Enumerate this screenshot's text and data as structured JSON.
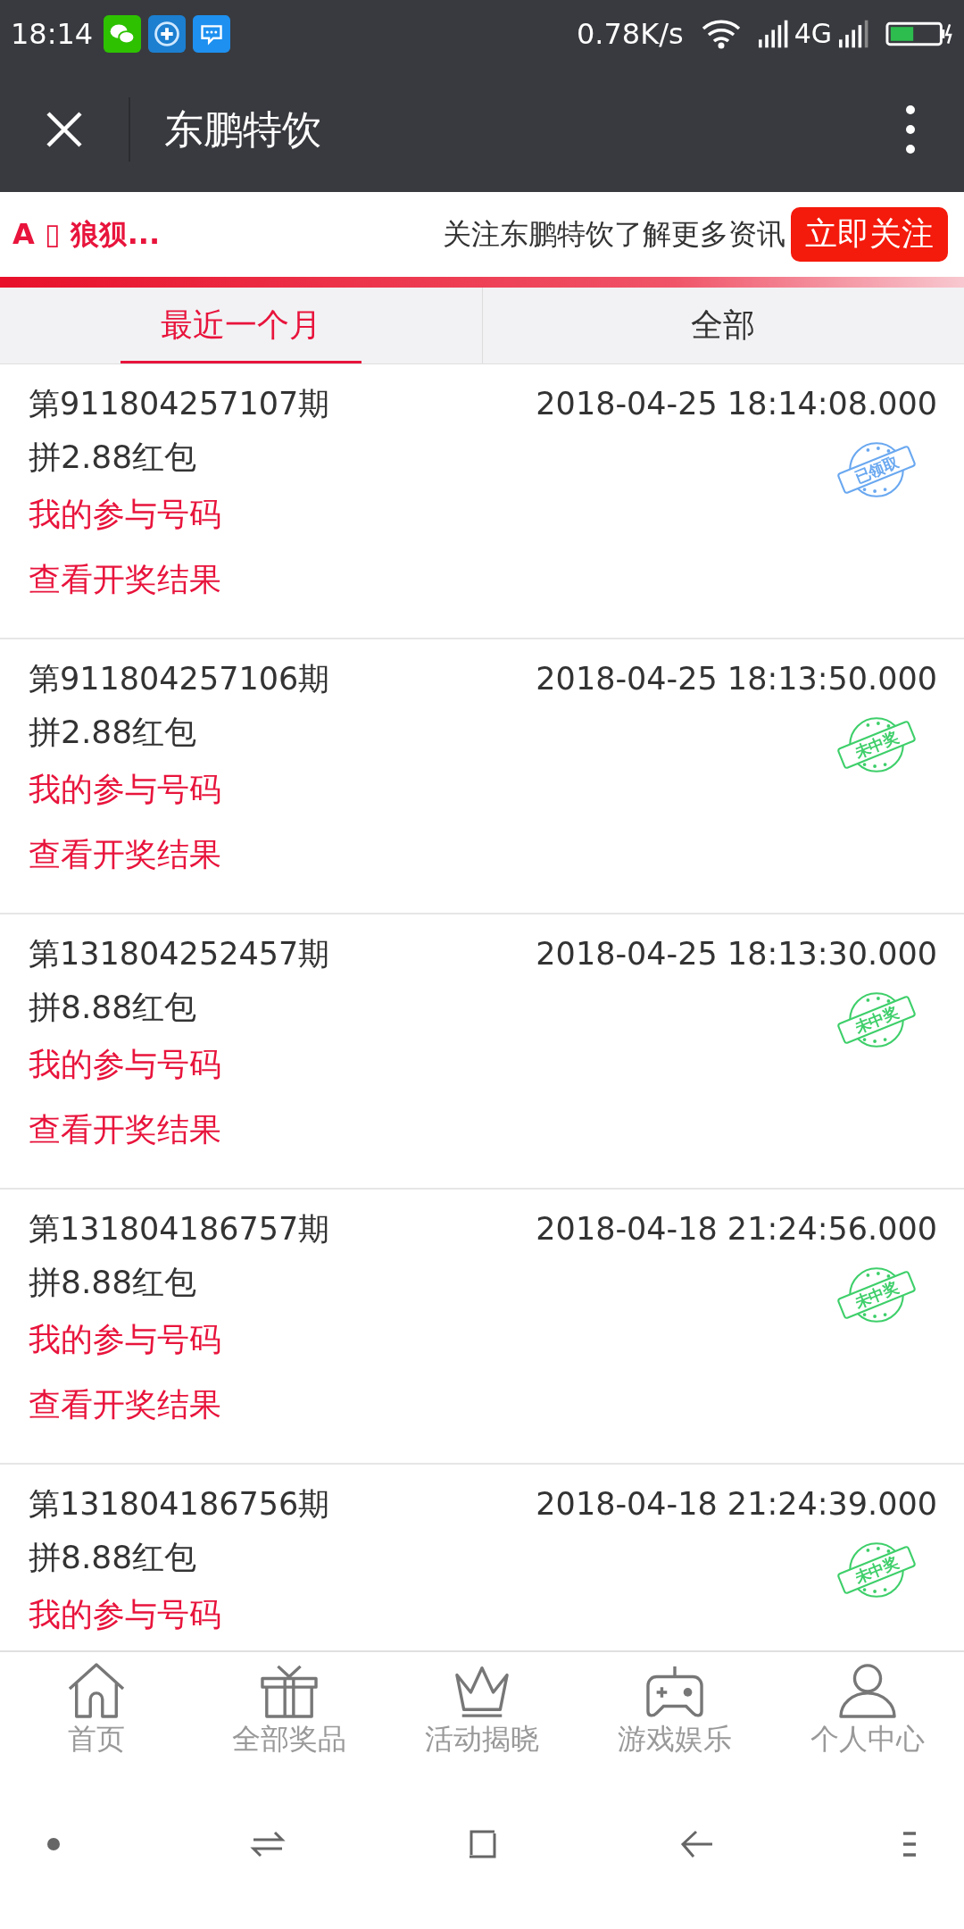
{
  "status_bar": {
    "time": "18:14",
    "speed": "0.78K/s",
    "network": "4G"
  },
  "header": {
    "title": "东鹏特饮"
  },
  "follow_bar": {
    "left_text": "A ▯ 狼狈...",
    "prompt": "关注东鹏特饮了解更多资讯",
    "button": "立即关注"
  },
  "tabs": [
    {
      "label": "最近一个月",
      "selected": true
    },
    {
      "label": "全部",
      "selected": false
    }
  ],
  "records": [
    {
      "period": "第911804257107期",
      "time": "2018-04-25 18:14:08.000",
      "prize": "拼2.88红包",
      "numbers_link": "我的参与号码",
      "result_link": "查看开奖结果",
      "stamp": {
        "kind": "claimed",
        "text": "已领取"
      }
    },
    {
      "period": "第911804257106期",
      "time": "2018-04-25 18:13:50.000",
      "prize": "拼2.88红包",
      "numbers_link": "我的参与号码",
      "result_link": "查看开奖结果",
      "stamp": {
        "kind": "lost",
        "text": "未中奖"
      }
    },
    {
      "period": "第131804252457期",
      "time": "2018-04-25 18:13:30.000",
      "prize": "拼8.88红包",
      "numbers_link": "我的参与号码",
      "result_link": "查看开奖结果",
      "stamp": {
        "kind": "lost",
        "text": "未中奖"
      }
    },
    {
      "period": "第131804186757期",
      "time": "2018-04-18 21:24:56.000",
      "prize": "拼8.88红包",
      "numbers_link": "我的参与号码",
      "result_link": "查看开奖结果",
      "stamp": {
        "kind": "lost",
        "text": "未中奖"
      }
    },
    {
      "period": "第131804186756期",
      "time": "2018-04-18 21:24:39.000",
      "prize": "拼8.88红包",
      "numbers_link": "我的参与号码",
      "stamp": {
        "kind": "lost",
        "text": "未中奖"
      }
    }
  ],
  "bottom_nav": [
    {
      "kind": "home",
      "label": "首页"
    },
    {
      "kind": "gift",
      "label": "全部奖品"
    },
    {
      "kind": "crown",
      "label": "活动揭晓"
    },
    {
      "kind": "game",
      "label": "游戏娱乐"
    },
    {
      "kind": "person",
      "label": "个人中心"
    }
  ]
}
